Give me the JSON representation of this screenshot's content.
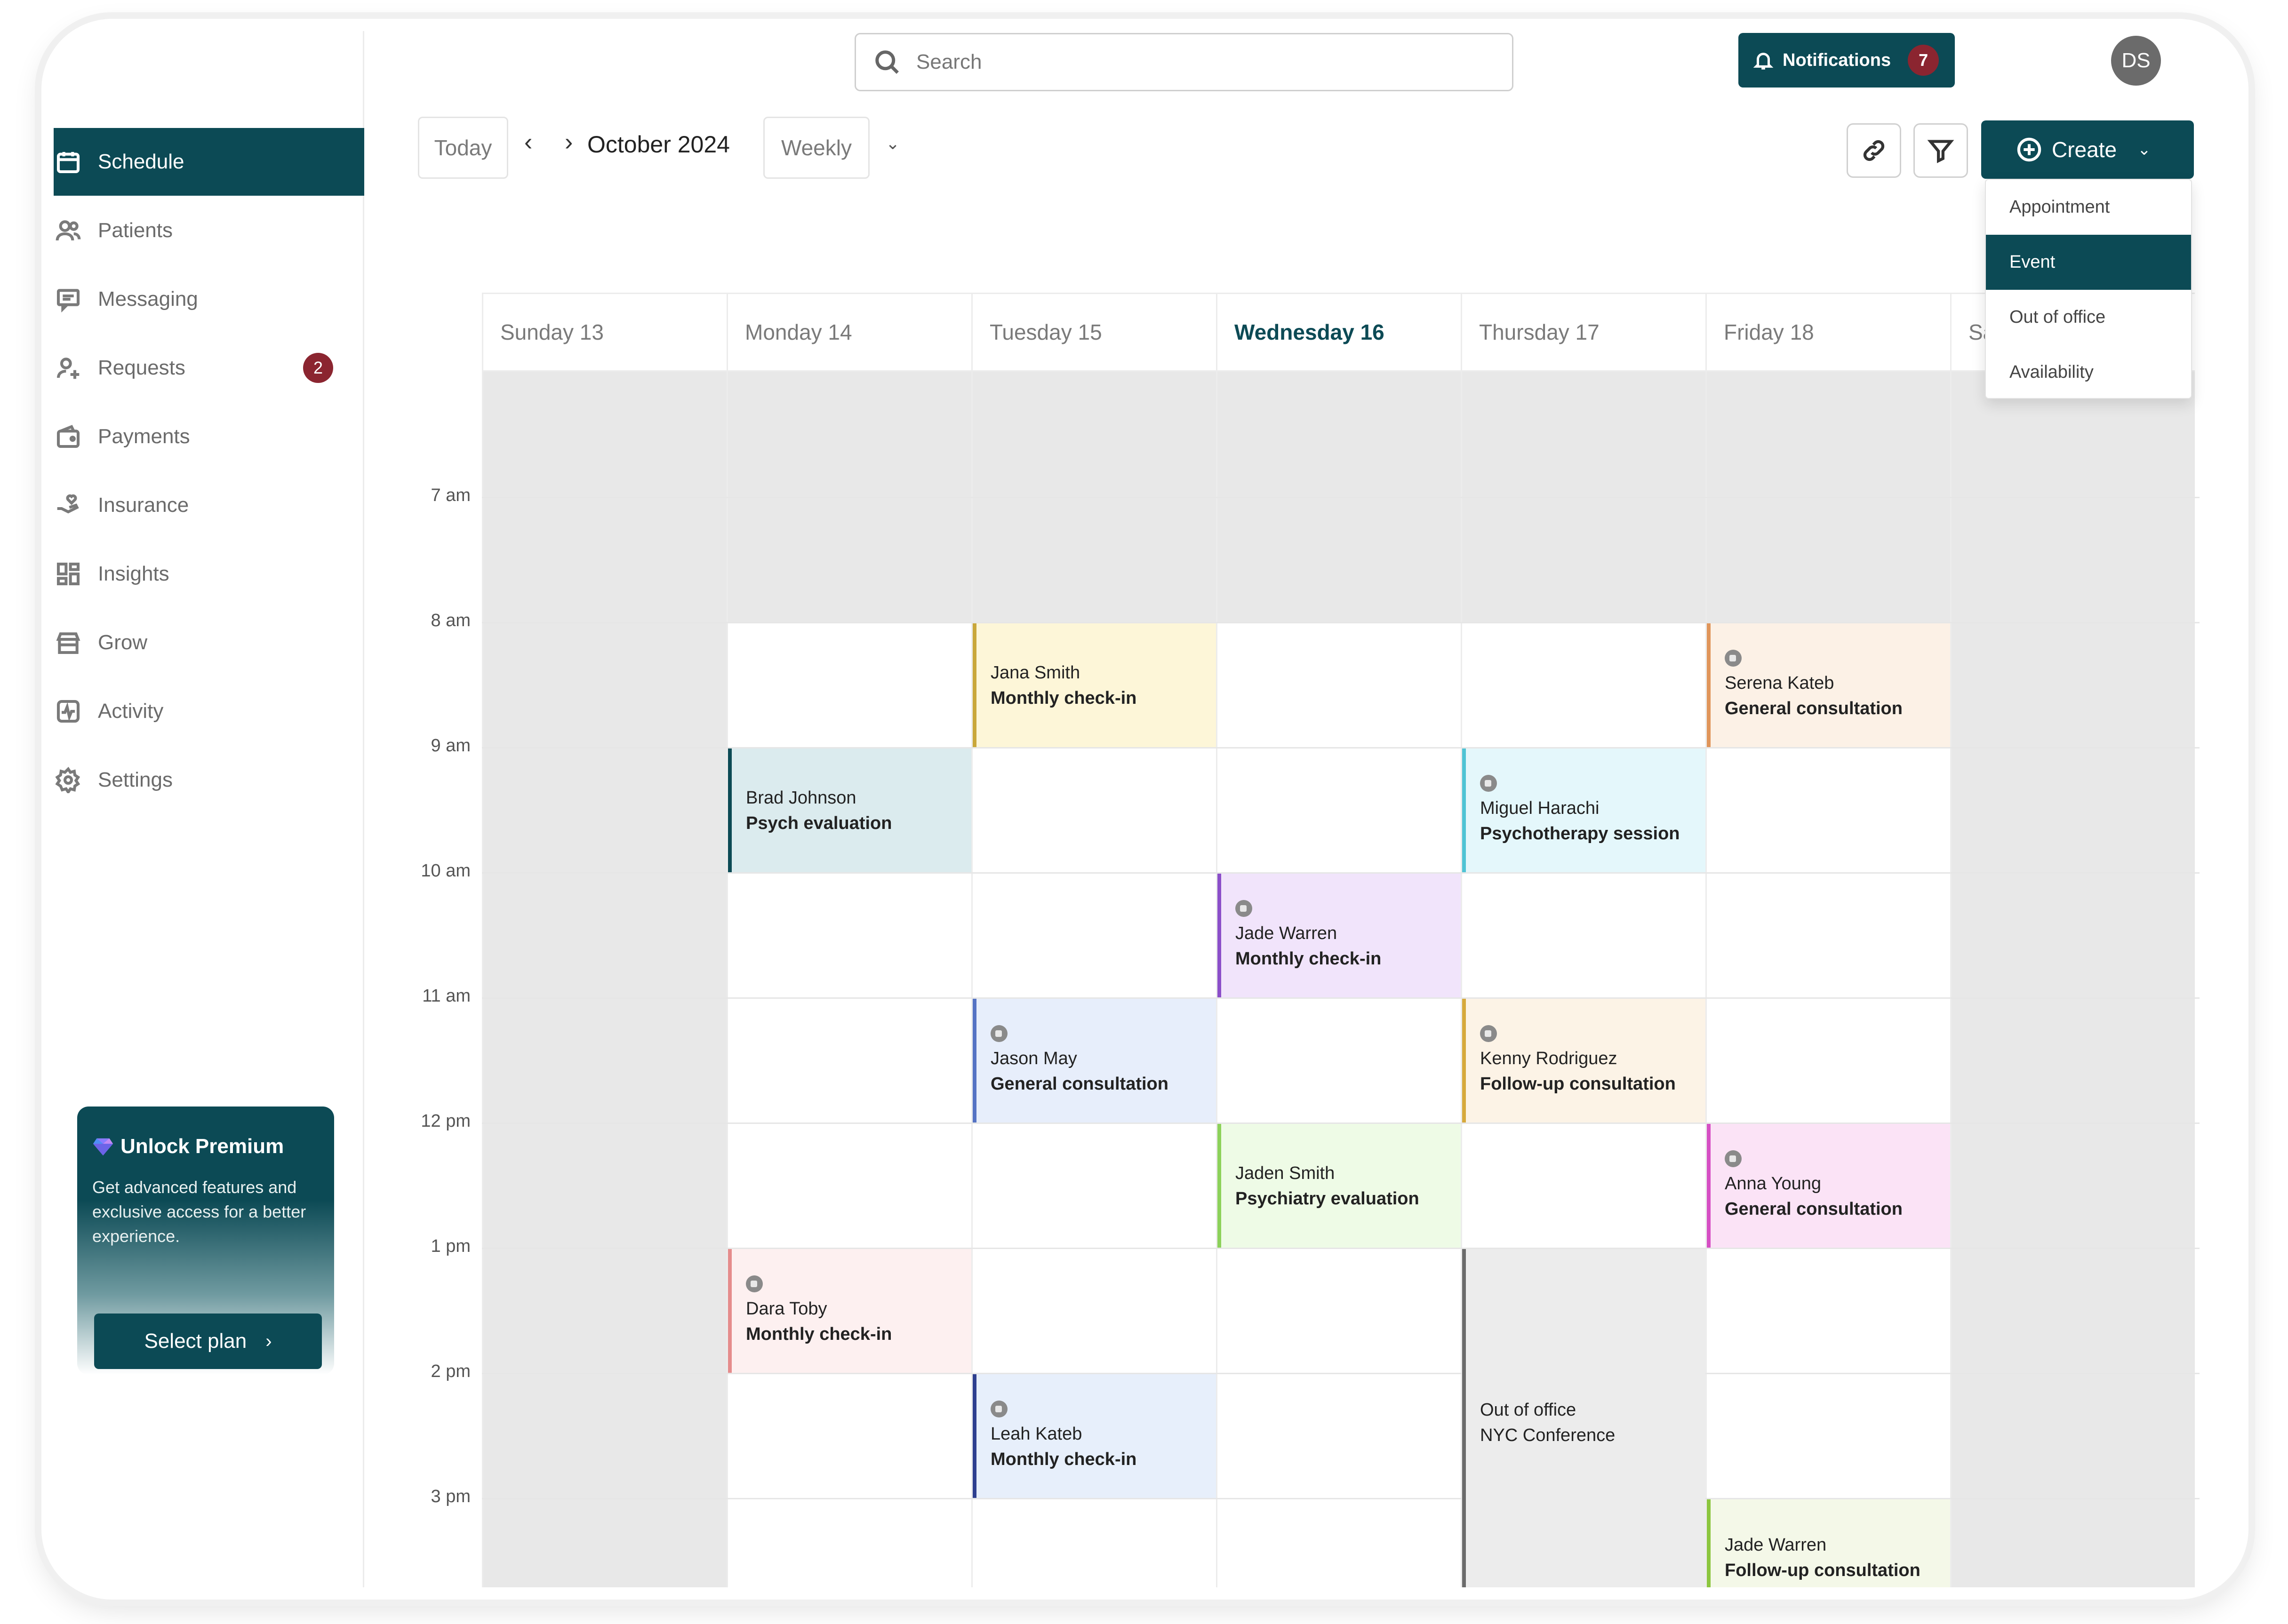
{
  "sidebar": {
    "items": [
      {
        "label": "Schedule",
        "icon": "calendar-icon",
        "active": true
      },
      {
        "label": "Patients",
        "icon": "users-icon"
      },
      {
        "label": "Messaging",
        "icon": "message-icon"
      },
      {
        "label": "Requests",
        "icon": "user-plus-icon",
        "badge": "2"
      },
      {
        "label": "Payments",
        "icon": "wallet-icon"
      },
      {
        "label": "Insurance",
        "icon": "hand-heart-icon"
      },
      {
        "label": "Insights",
        "icon": "dashboard-icon"
      },
      {
        "label": "Grow",
        "icon": "store-icon"
      },
      {
        "label": "Activity",
        "icon": "activity-icon"
      },
      {
        "label": "Settings",
        "icon": "gear-icon"
      }
    ],
    "premium": {
      "title": "Unlock Premium",
      "description": "Get advanced features and exclusive access for a better experience.",
      "button": "Select plan"
    }
  },
  "header": {
    "search_placeholder": "Search",
    "notifications_label": "Notifications",
    "notifications_count": "7",
    "avatar_initials": "DS"
  },
  "toolbar": {
    "today_label": "Today",
    "month_label": "October 2024",
    "view_label": "Weekly",
    "create_label": "Create",
    "create_menu": [
      "Appointment",
      "Event",
      "Out of office",
      "Availability"
    ],
    "create_menu_active": "Event"
  },
  "calendar": {
    "days": [
      "Sunday 13",
      "Monday 14",
      "Tuesday 15",
      "Wednesday 16",
      "Thursday 17",
      "Friday 18",
      "Sa"
    ],
    "today_index": 3,
    "times": [
      "7 am",
      "8 am",
      "9 am",
      "10 am",
      "11 am",
      "12 pm",
      "1 pm",
      "2 pm",
      "3 pm"
    ],
    "events": [
      {
        "day": 2,
        "start": 8,
        "end": 9,
        "name": "Jana Smith",
        "type": "Monthly check-in",
        "video": false,
        "bg": "#fdf6d8",
        "accent": "#c9a73a"
      },
      {
        "day": 5,
        "start": 8,
        "end": 9,
        "name": "Serena Kateb",
        "type": "General consultation",
        "video": true,
        "bg": "#fcf1e6",
        "accent": "#e0955a"
      },
      {
        "day": 1,
        "start": 9,
        "end": 10,
        "name": "Brad Johnson",
        "type": "Psych evaluation",
        "video": false,
        "bg": "#dbebee",
        "accent": "#0c4a55"
      },
      {
        "day": 4,
        "start": 9,
        "end": 10,
        "name": "Miguel Harachi",
        "type": "Psychotherapy session",
        "video": true,
        "bg": "#e4f7fb",
        "accent": "#4fc3d4"
      },
      {
        "day": 3,
        "start": 10,
        "end": 11,
        "name": "Jade Warren",
        "type": "Monthly check-in",
        "video": true,
        "bg": "#f1e4fb",
        "accent": "#8b4fc9"
      },
      {
        "day": 2,
        "start": 11,
        "end": 12,
        "name": "Jason May",
        "type": "General consultation",
        "video": true,
        "bg": "#e7eefb",
        "accent": "#5573c4"
      },
      {
        "day": 4,
        "start": 11,
        "end": 12,
        "name": "Kenny Rodriguez",
        "type": "Follow-up consultation",
        "video": true,
        "bg": "#fcf3e6",
        "accent": "#d6a93c"
      },
      {
        "day": 3,
        "start": 12,
        "end": 13,
        "name": "Jaden Smith",
        "type": "Psychiatry evaluation",
        "video": false,
        "bg": "#eefbe6",
        "accent": "#8cd15a"
      },
      {
        "day": 5,
        "start": 12,
        "end": 13,
        "name": "Anna Young",
        "type": "General consultation",
        "video": true,
        "bg": "#fbe3f6",
        "accent": "#d64fc4"
      },
      {
        "day": 1,
        "start": 13,
        "end": 14,
        "name": "Dara Toby",
        "type": "Monthly check-in",
        "video": true,
        "bg": "#fdf0f0",
        "accent": "#e58c8c"
      },
      {
        "day": 2,
        "start": 14,
        "end": 15,
        "name": "Leah Kateb",
        "type": "Monthly check-in",
        "video": true,
        "bg": "#e7effb",
        "accent": "#2e3f8f"
      },
      {
        "day": 4,
        "start": 13,
        "end": 16,
        "name": "Out of office",
        "type": "NYC Conference",
        "video": false,
        "bg": "#ececec",
        "accent": "#6b6b6b",
        "ooo": true
      },
      {
        "day": 5,
        "start": 15,
        "end": 16,
        "name": "Jade Warren",
        "type": "Follow-up consultation",
        "video": false,
        "bg": "#f4f8e8",
        "accent": "#8cc63f"
      }
    ]
  }
}
